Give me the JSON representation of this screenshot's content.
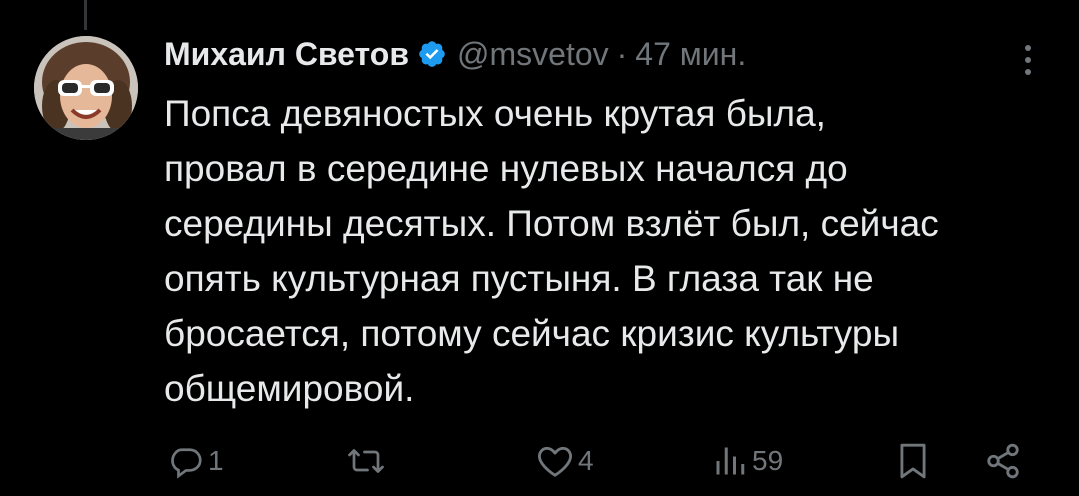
{
  "tweet": {
    "author_name": "Михаил Светов",
    "handle": "@msvetov",
    "separator": "·",
    "time": "47 мин.",
    "text_lines": [
      "Попса девяностых очень крутая была,",
      "провал в середине нулевых начался до",
      "середины десятых. Потом взлёт был, сейчас",
      "опять культурная пустыня. В глаза так не",
      "бросается, потому сейчас кризис культуры",
      "общемировой."
    ]
  },
  "actions": {
    "reply_count": "1",
    "retweet_count": "",
    "like_count": "4",
    "views_count": "59"
  },
  "icons": {
    "verified": "verified-badge-icon",
    "more": "more-options-icon",
    "reply": "reply-icon",
    "retweet": "retweet-icon",
    "like": "heart-icon",
    "views": "views-icon",
    "bookmark": "bookmark-icon",
    "share": "share-icon"
  },
  "colors": {
    "background": "#000000",
    "text": "#e7e9ea",
    "secondary": "#71767b",
    "verified": "#1d9bf0"
  }
}
